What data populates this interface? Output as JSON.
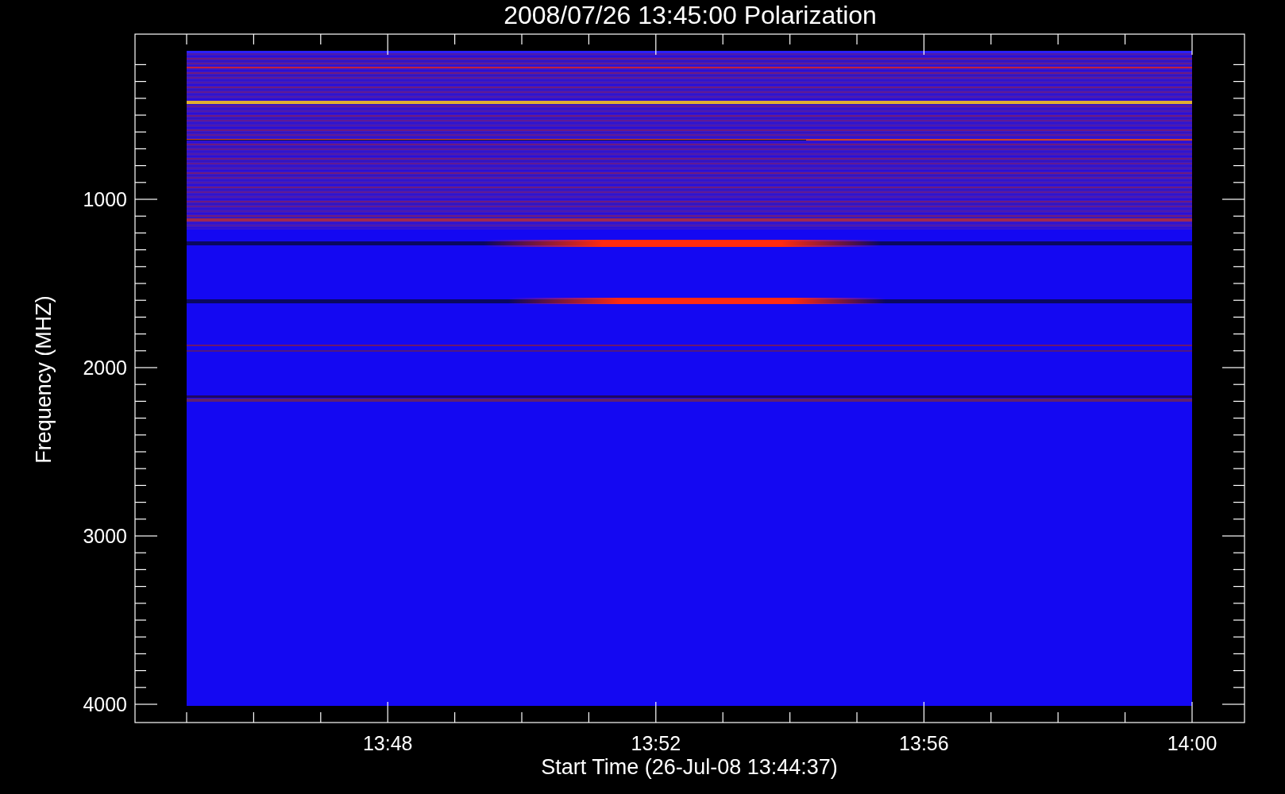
{
  "title": "2008/07/26 13:45:00 Polarization",
  "y_axis": {
    "label": "Frequency (MHZ)",
    "ticks": [
      "1000",
      "2000",
      "3000",
      "4000"
    ]
  },
  "x_axis": {
    "label": "Start Time (26-Jul-08 13:44:37)",
    "ticks": [
      "13:48",
      "13:52",
      "13:56",
      "14:00"
    ]
  }
}
